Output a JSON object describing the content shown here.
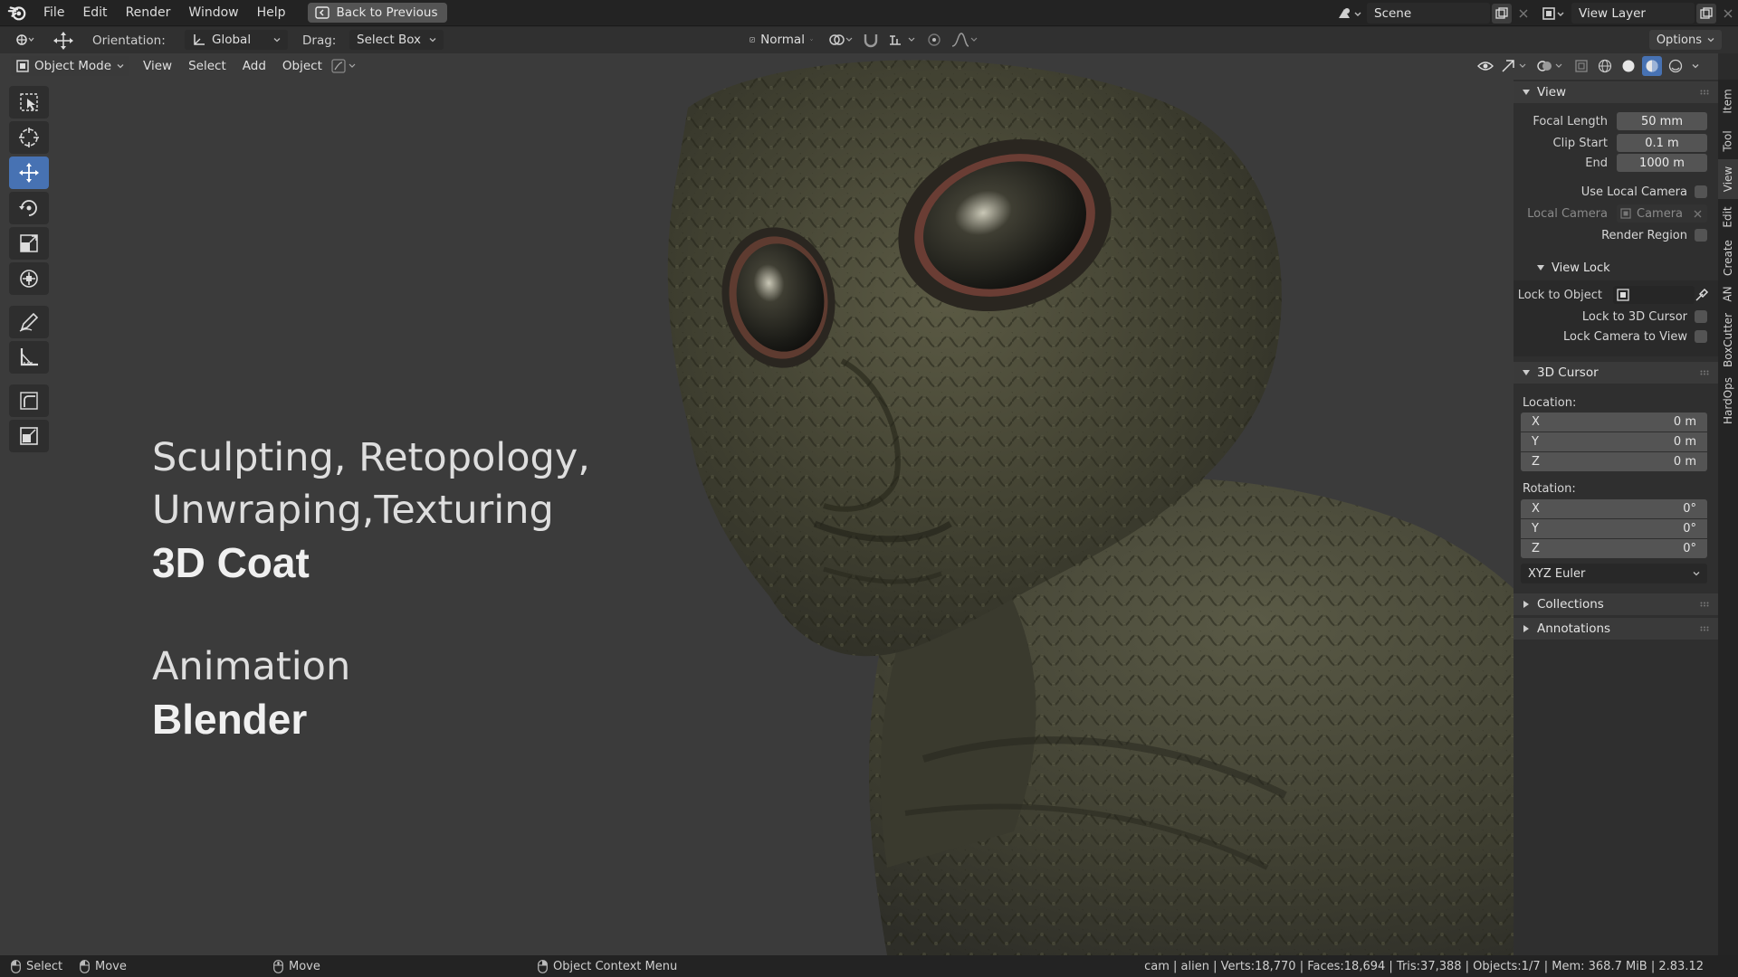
{
  "menubar": {
    "items": [
      "File",
      "Edit",
      "Render",
      "Window",
      "Help"
    ],
    "back_button": "Back to Previous",
    "scene": "Scene",
    "view_layer": "View Layer"
  },
  "header": {
    "orientation_label": "Orientation:",
    "orientation_value": "Global",
    "drag_label": "Drag:",
    "drag_value": "Select Box",
    "pivot_value": "Normal",
    "options": "Options"
  },
  "viewport": {
    "mode": "Object Mode",
    "menus": [
      "View",
      "Select",
      "Add",
      "Object"
    ],
    "tools": [
      "select-box",
      "cursor",
      "move",
      "rotate",
      "scale",
      "transform",
      "annotate",
      "measure",
      "add-cube",
      "add-shape"
    ],
    "overlay_lines": [
      {
        "text": "Sculpting, Retopology,",
        "style": "light"
      },
      {
        "text": "Unwraping,Texturing",
        "style": "light"
      },
      {
        "text": "3D Coat",
        "style": "bold"
      },
      {
        "text": "Animation",
        "style": "light"
      },
      {
        "text": "Blender",
        "style": "bold"
      }
    ]
  },
  "npanel": {
    "tabs": [
      "Item",
      "Tool",
      "View",
      "Edit",
      "Create",
      "AN",
      "BoxCutter",
      "HardOps"
    ],
    "active_tab": "View",
    "view": {
      "title": "View",
      "focal_length_label": "Focal Length",
      "focal_length": "50 mm",
      "clip_start_label": "Clip Start",
      "clip_start": "0.1 m",
      "end_label": "End",
      "end": "1000 m",
      "use_local_camera": "Use Local Camera",
      "local_camera_label": "Local Camera",
      "local_camera_value": "Camera",
      "render_region": "Render Region"
    },
    "view_lock": {
      "title": "View Lock",
      "lock_to_object": "Lock to Object",
      "lock_to_cursor": "Lock to 3D Cursor",
      "lock_camera": "Lock Camera to View"
    },
    "cursor": {
      "title": "3D Cursor",
      "location_label": "Location:",
      "location": [
        {
          "axis": "X",
          "value": "0 m"
        },
        {
          "axis": "Y",
          "value": "0 m"
        },
        {
          "axis": "Z",
          "value": "0 m"
        }
      ],
      "rotation_label": "Rotation:",
      "rotation": [
        {
          "axis": "X",
          "value": "0°"
        },
        {
          "axis": "Y",
          "value": "0°"
        },
        {
          "axis": "Z",
          "value": "0°"
        }
      ],
      "rotation_mode": "XYZ Euler"
    },
    "collections": "Collections",
    "annotations": "Annotations"
  },
  "statusbar": {
    "select": "Select",
    "move1": "Move",
    "move2": "Move",
    "context_menu": "Object Context Menu",
    "stats": "cam | alien | Verts:18,770 | Faces:18,694 | Tris:37,388 | Objects:1/7 | Mem: 368.7 MiB | 2.83.12"
  },
  "colors": {
    "accent": "#4772b3",
    "background": "#3b3b3b",
    "panel": "#2f2f2f"
  }
}
